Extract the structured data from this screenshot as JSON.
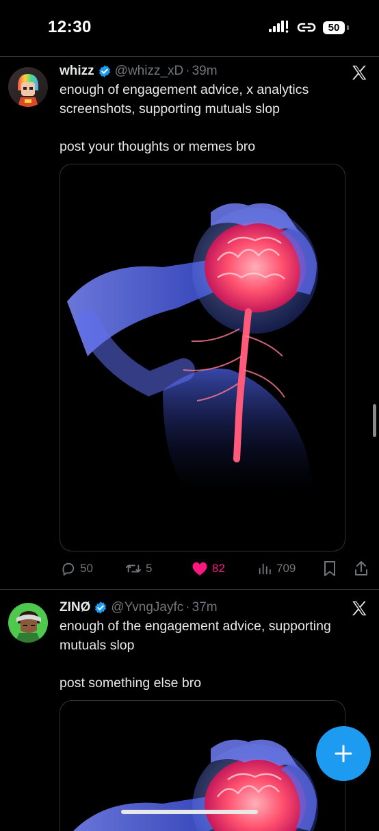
{
  "status_bar": {
    "time": "12:30",
    "battery": "50"
  },
  "posts": [
    {
      "display_name": "whizz",
      "handle": "@whizz_xD",
      "separator": "·",
      "time": "39m",
      "text_lines": [
        "enough of engagement advice, x analytics",
        "screenshots, supporting mutuals slop",
        "",
        "post your thoughts or memes bro"
      ],
      "media_icon": "brain-headache-illustration",
      "actions": {
        "replies": "50",
        "reposts": "5",
        "likes": "82",
        "views": "709"
      }
    },
    {
      "display_name": "ZINØ",
      "handle": "@YvngJayfc",
      "separator": "·",
      "time": "37m",
      "text_lines": [
        "enough of the engagement advice, supporting",
        "mutuals slop",
        "",
        "post something else bro"
      ],
      "media_icon": "brain-headache-illustration"
    }
  ],
  "colors": {
    "background": "#000000",
    "accent": "#1d9bf0",
    "like": "#f91880",
    "muted": "#71767b",
    "text": "#e7e9ea"
  },
  "icons": {
    "verified": "verified-badge-icon",
    "platform": "x-logo-icon",
    "compose": "plus-icon"
  }
}
